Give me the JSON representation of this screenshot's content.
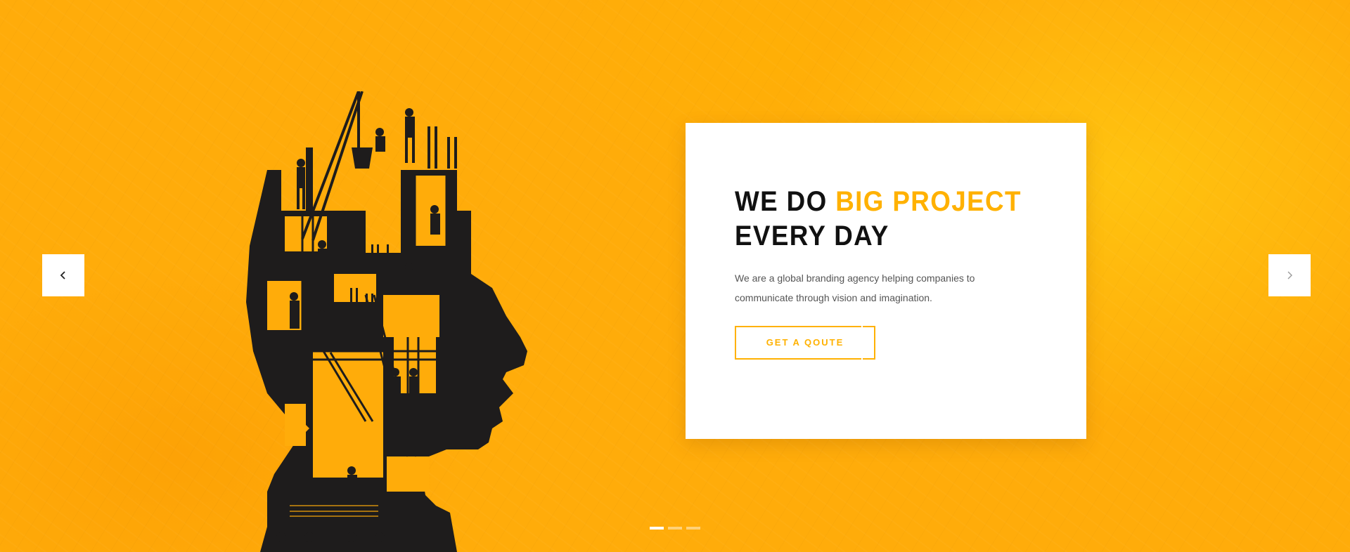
{
  "slide": {
    "title_part1": "WE DO ",
    "title_accent": "BIG PROJECT",
    "title_part2": "EVERY DAY",
    "description": "We are a global branding agency helping companies to communicate through vision and imagination.",
    "cta_label": "GET A QOUTE"
  },
  "slider": {
    "prev_icon": "chevron-left-icon",
    "next_icon": "chevron-right-icon",
    "slide_count": 3,
    "active_slide": 1
  },
  "colors": {
    "background": "#ffac0a",
    "accent": "#ffb100",
    "silhouette": "#1e1c1c",
    "title": "#111111",
    "text": "#555555"
  },
  "illustration": {
    "icon": "construction-head-silhouette-illustration"
  }
}
